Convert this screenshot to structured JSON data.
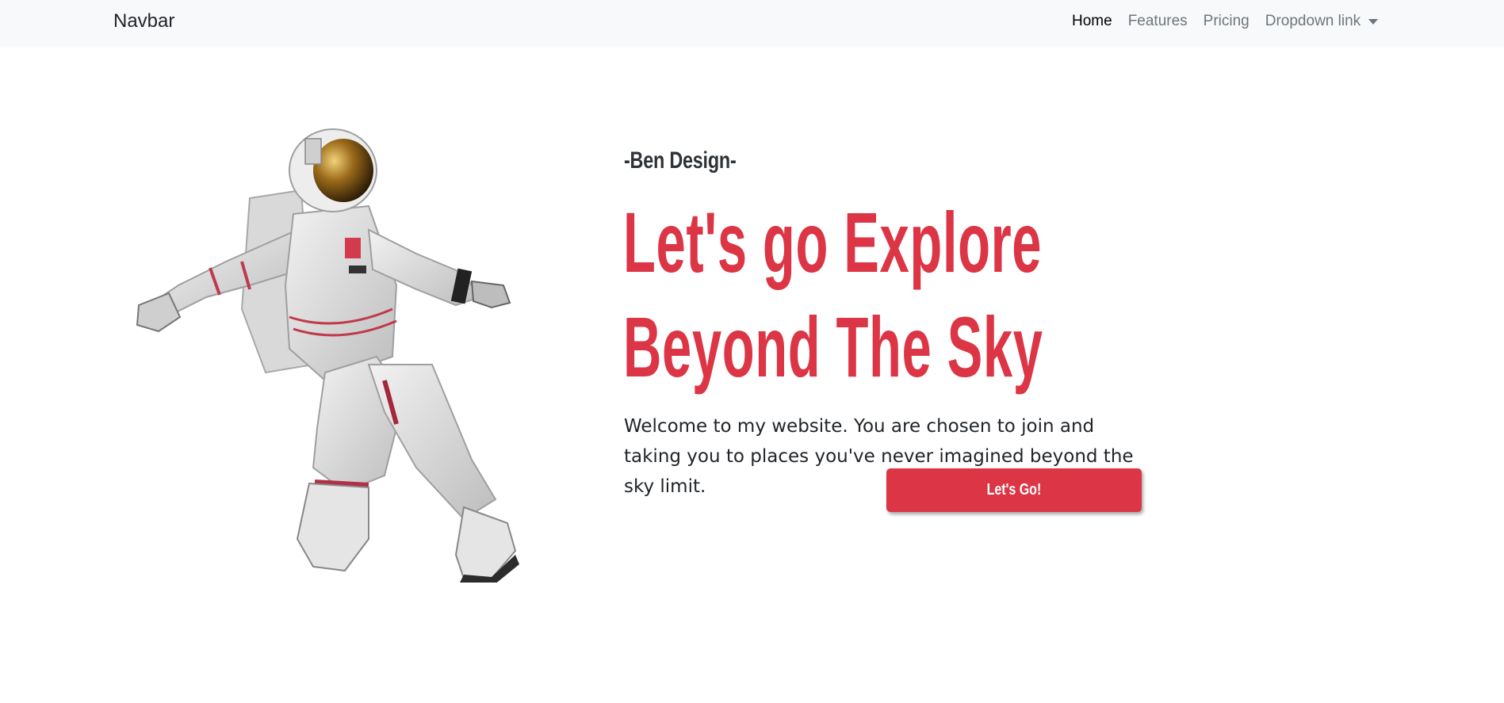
{
  "navbar": {
    "brand": "Navbar",
    "links": [
      {
        "label": "Home",
        "active": true
      },
      {
        "label": "Features",
        "active": false
      },
      {
        "label": "Pricing",
        "active": false
      }
    ],
    "dropdown_label": "Dropdown link"
  },
  "hero": {
    "subtitle": "-Ben Design-",
    "title_line1": "Let's go Explore",
    "title_line2": "Beyond The Sky",
    "text": "Welcome to my website. You are chosen to join and taking you to places you've never imagined beyond the sky limit.",
    "cta_label": "Let's Go!"
  },
  "colors": {
    "accent": "#dc3545",
    "navbar_bg": "#f8f9fa",
    "text": "#212529"
  },
  "icons": {
    "dropdown": "caret-down-icon",
    "hero_image": "astronaut-image"
  }
}
